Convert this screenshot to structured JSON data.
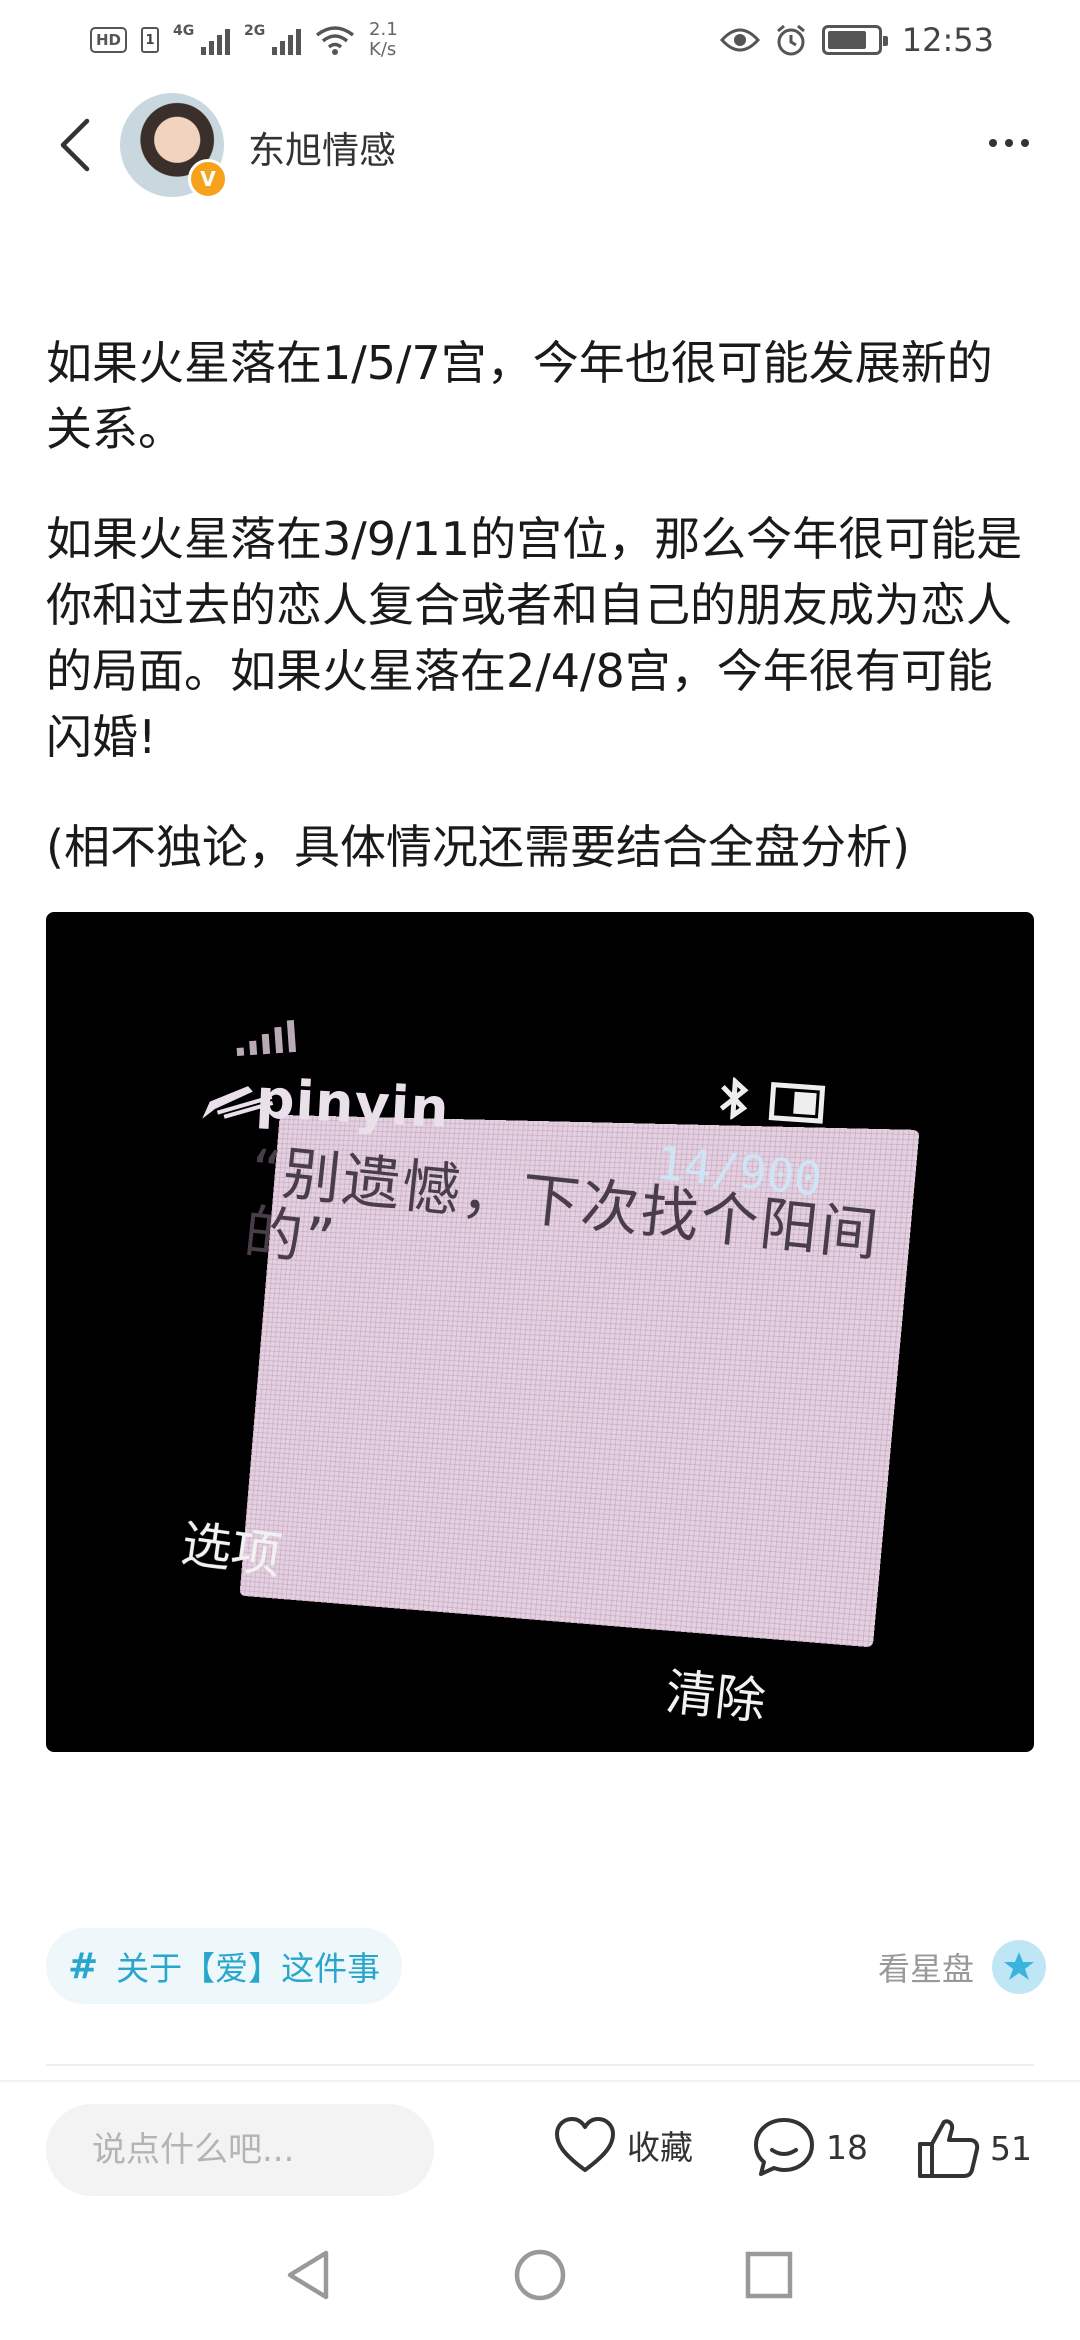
{
  "status_bar": {
    "hd_label": "HD",
    "sim_label": "1",
    "signal1_label": "4G",
    "signal2_label": "2G",
    "speed_value": "2.1",
    "speed_unit": "K/s",
    "time": "12:53"
  },
  "header": {
    "author_name": "东旭情感",
    "verified_badge": "V"
  },
  "article": {
    "paragraphs": [
      "如果火星落在1/5/7宫，今年也很可能发展新的关系。",
      "如果火星落在3/9/11的宫位，那么今年很可能是你和过去的恋人复合或者和自己的朋友成为恋人的局面。如果火星落在2/4/8宫，今年很有可能闪婚!",
      "(相不独论，具体情况还需要结合全盘分析)"
    ]
  },
  "image": {
    "input_mode": "pinyin",
    "char_count": "14/900",
    "message_text": "“别遗憾，下次找个阳间的”",
    "softkey_left": "选项",
    "softkey_right": "清除"
  },
  "topic": {
    "hash_symbol": "#",
    "label": "关于【爱】这件事"
  },
  "chart_link": {
    "label": "看星盘"
  },
  "action_bar": {
    "comment_placeholder": "说点什么吧...",
    "favorite_label": "收藏",
    "comment_count": "18",
    "like_count": "51"
  },
  "colors": {
    "accent": "#29a6cc",
    "chip_bg": "#eef8fb",
    "badge": "#f7a21b"
  }
}
